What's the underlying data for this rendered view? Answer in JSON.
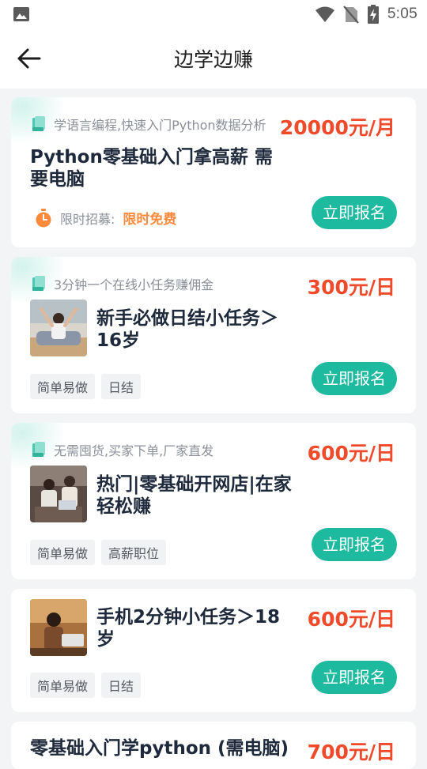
{
  "status_bar": {
    "time": "5:05",
    "icons": [
      "image-icon",
      "wifi-icon",
      "no-sim-icon",
      "battery-charging-icon"
    ]
  },
  "header": {
    "title": "边学边赚",
    "back_icon": "back-arrow-icon"
  },
  "colors": {
    "accent": "#1dbaa0",
    "price": "#f04a2a",
    "limit": "#ff8a3d"
  },
  "cards": [
    {
      "subtitle": "学语言编程,快速入门Python数据分析",
      "price": "20000元/月",
      "title": "Python零基础入门拿高薪 需要电脑",
      "limit_label": "限时招募:",
      "limit_value": "限时免费",
      "button": "立即报名"
    },
    {
      "subtitle": "3分钟一个在线小任务赚佣金",
      "price": "300元/日",
      "title": "新手必做日结小任务＞16岁",
      "tags": [
        "简单易做",
        "日结"
      ],
      "button": "立即报名"
    },
    {
      "subtitle": "无需囤货,买家下单,厂家直发",
      "price": "600元/日",
      "title": "热门|零基础开网店|在家轻松赚",
      "tags": [
        "简单易做",
        "高薪职位"
      ],
      "button": "立即报名"
    },
    {
      "price": "600元/日",
      "title": "手机2分钟小任务＞18岁",
      "tags": [
        "简单易做",
        "日结"
      ],
      "button": "立即报名"
    },
    {
      "price": "700元/日",
      "title": "零基础入门学python (需电脑)"
    }
  ]
}
